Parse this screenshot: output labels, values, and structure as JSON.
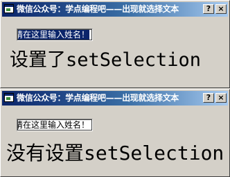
{
  "windows": [
    {
      "title": "微信公众号：学点编程吧——出现就选择文本",
      "help_label": "?",
      "close_label": "×",
      "input_value": "请在这里输入姓名！",
      "caption": "设置了setSelection"
    },
    {
      "title": "微信公众号：学点编程吧——出现就选择文本",
      "help_label": "?",
      "close_label": "×",
      "input_value": "请在这里输入姓名！",
      "caption": "没有设置setSelection"
    }
  ]
}
